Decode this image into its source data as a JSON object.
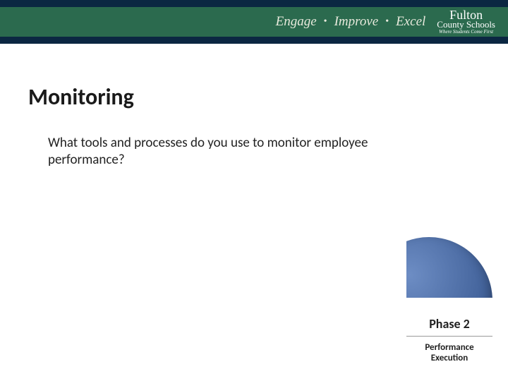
{
  "header": {
    "tagline_word1": "Engage",
    "tagline_word2": "Improve",
    "tagline_word3": "Excel",
    "logo_line1": "Fulton",
    "logo_line2": "County Schools",
    "logo_sub": "Where Students Come First"
  },
  "slide": {
    "title": "Monitoring",
    "body": "What tools and processes do you use to monitor employee performance?"
  },
  "phase": {
    "label": "Phase 2",
    "sublabel_line1": "Performance",
    "sublabel_line2": "Execution"
  }
}
